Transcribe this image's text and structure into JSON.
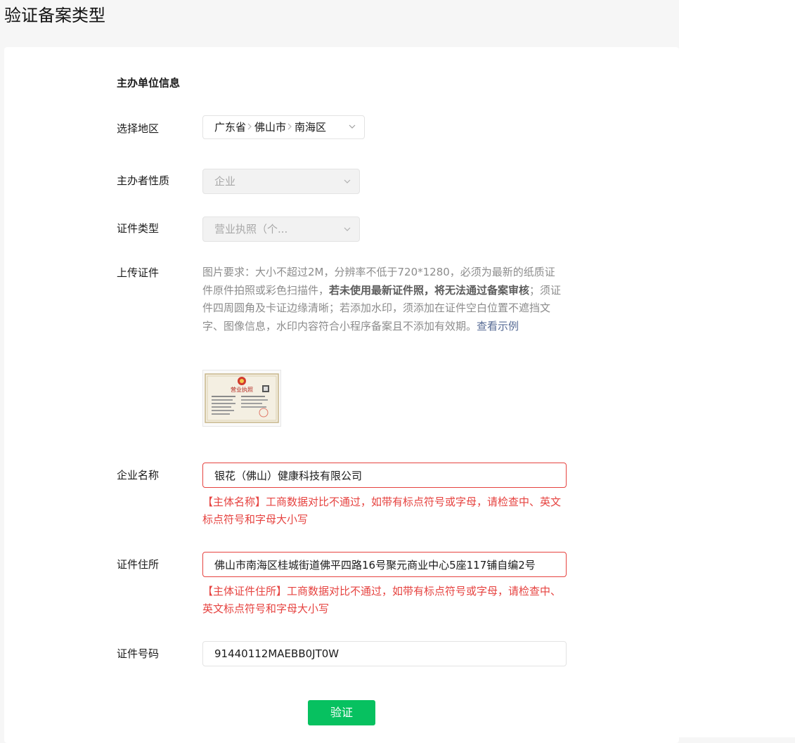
{
  "page": {
    "title": "验证备案类型"
  },
  "form": {
    "section_title": "主办单位信息",
    "region": {
      "label": "选择地区",
      "province": "广东省",
      "city": "佛山市",
      "district": "南海区"
    },
    "host_nature": {
      "label": "主办者性质",
      "value": "企业"
    },
    "cert_type": {
      "label": "证件类型",
      "value": "营业执照（个..."
    },
    "upload": {
      "label": "上传证件",
      "help_part1": "图片要求：大小不超过2M，分辨率不低于720*1280，必须为最新的纸质证件原件拍照或彩色扫描件，",
      "help_bold": "若未使用最新证件照，将无法通过备案审核",
      "help_part2": "；须证件四周圆角及卡证边缘清晰；若添加水印，须添加在证件空白位置不遮挡文字、图像信息，水印内容符合小程序备案且不添加有效期。",
      "help_link": "查看示例",
      "sample_title": "营业执照"
    },
    "company_name": {
      "label": "企业名称",
      "value": "银花（佛山）健康科技有限公司",
      "error": "【主体名称】工商数据对比不通过，如带有标点符号或字母，请检查中、英文标点符号和字母大小写"
    },
    "cert_address": {
      "label": "证件住所",
      "value": "佛山市南海区桂城街道佛平四路16号聚元商业中心5座117铺自编2号",
      "error": "【主体证件住所】工商数据对比不通过，如带有标点符号或字母，请检查中、英文标点符号和字母大小写"
    },
    "cert_number": {
      "label": "证件号码",
      "value": "91440112MAEBB0JT0W"
    },
    "verify_label": "验证"
  },
  "colors": {
    "primary": "#07c160",
    "error": "#e64340",
    "link": "#576b95"
  },
  "icons": {
    "select_arrow": "chevron-down-icon",
    "region_separator": "chevron-right-icon"
  }
}
